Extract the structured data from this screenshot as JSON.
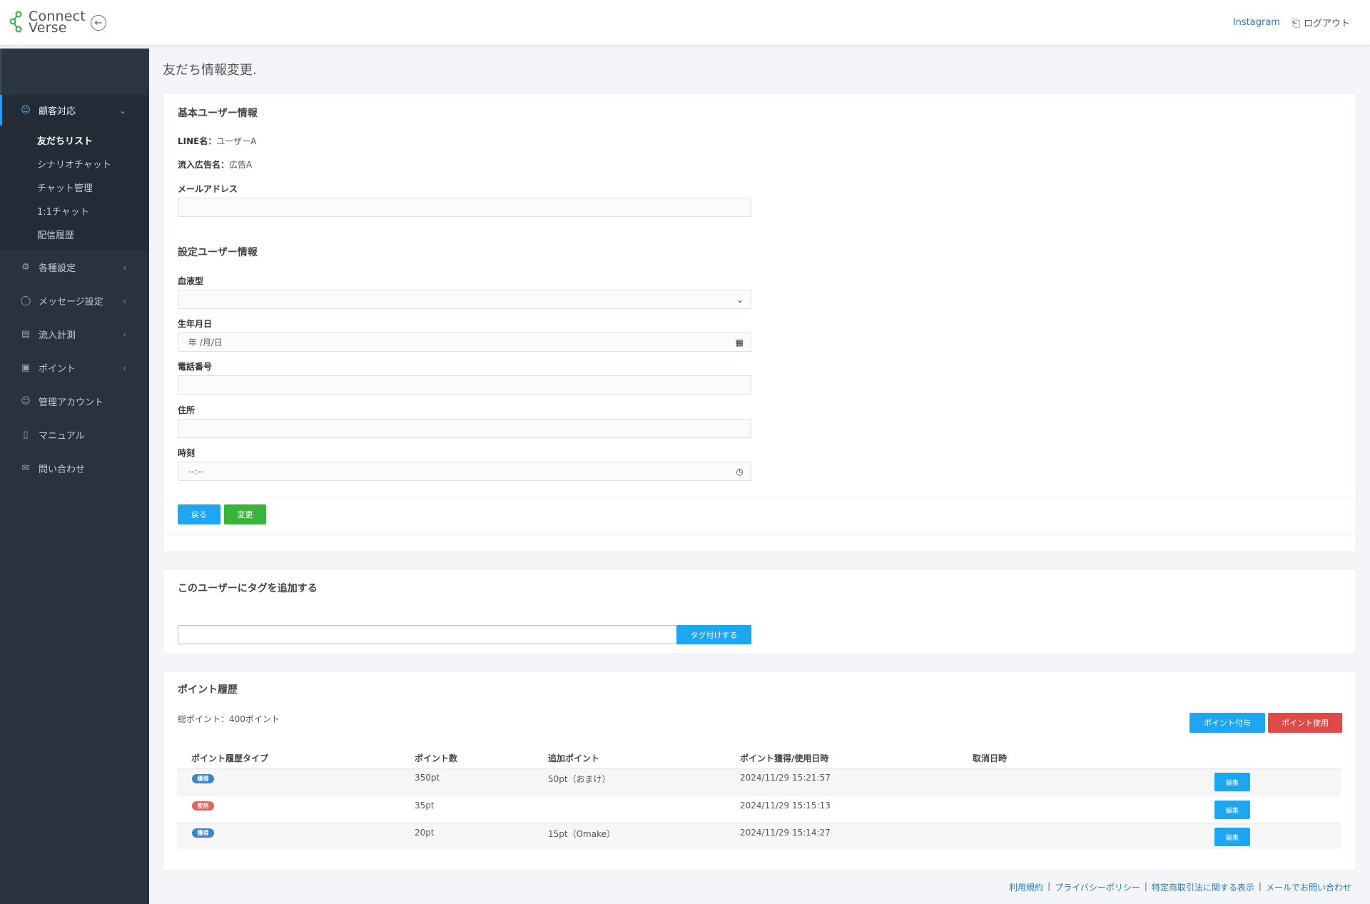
{
  "header": {
    "logo_line1": "Connect",
    "logo_line2": "Verse",
    "collapse_icon": "arrow-left-circle-icon",
    "instagram_link": "Instagram",
    "logout_label": "ログアウト"
  },
  "sidebar": {
    "active_section": "顧客対応",
    "sub_items": [
      "友だちリスト",
      "シナリオチャット",
      "チャット管理",
      "1:1チャット",
      "配信履歴"
    ],
    "active_sub": "友だちリスト",
    "items": [
      {
        "label": "各種設定",
        "icon": "gear-icon",
        "has_children": true
      },
      {
        "label": "メッセージ設定",
        "icon": "chat-bubble-icon",
        "has_children": true
      },
      {
        "label": "流入計測",
        "icon": "bar-chart-icon",
        "has_children": true
      },
      {
        "label": "ポイント",
        "icon": "gift-icon",
        "has_children": true
      },
      {
        "label": "管理アカウント",
        "icon": "user-icon",
        "has_children": false
      },
      {
        "label": "マニュアル",
        "icon": "book-icon",
        "has_children": false
      },
      {
        "label": "問い合わせ",
        "icon": "mail-icon",
        "has_children": false
      }
    ]
  },
  "page": {
    "title": "友だち情報変更."
  },
  "basic_info": {
    "title": "基本ユーザー情報",
    "line_name_label": "LINE名：",
    "line_name_value": "ユーザーA",
    "ad_label": "流入広告名：",
    "ad_value": "広告A",
    "email_label": "メールアドレス",
    "email_value": ""
  },
  "settings_info": {
    "title": "設定ユーザー情報",
    "blood_label": "血液型",
    "blood_value": "",
    "birth_label": "生年月日",
    "birth_placeholder": "年 /月/日",
    "phone_label": "電話番号",
    "phone_value": "",
    "address_label": "住所",
    "address_value": "",
    "time_label": "時刻",
    "time_placeholder": "--:--"
  },
  "form_actions": {
    "back_label": "戻る",
    "submit_label": "変更"
  },
  "tag_section": {
    "title": "このユーザーにタグを追加する",
    "input_value": "",
    "button_label": "タグ付けする"
  },
  "points": {
    "title": "ポイント履歴",
    "total_label": "総ポイント：",
    "total_value": "400ポイント",
    "grant_button": "ポイント付与",
    "use_button": "ポイント使用",
    "columns": [
      "ポイント履歴タイプ",
      "ポイント数",
      "追加ポイント",
      "ポイント獲得/使用日時",
      "取消日時"
    ],
    "edit_label": "編集",
    "rows": [
      {
        "type": "獲得",
        "type_color": "blue",
        "points": "350pt",
        "extra": "50pt（おまけ）",
        "datetime": "2024/11/29 15:21:57",
        "cancelled": ""
      },
      {
        "type": "使用",
        "type_color": "red",
        "points": "35pt",
        "extra": "",
        "datetime": "2024/11/29 15:15:13",
        "cancelled": ""
      },
      {
        "type": "獲得",
        "type_color": "blue",
        "points": "20pt",
        "extra": "15pt（Omake）",
        "datetime": "2024/11/29 15:14:27",
        "cancelled": ""
      }
    ]
  },
  "footer": {
    "links": [
      "利用規約",
      "プライバシーポリシー",
      "特定商取引法に関する表示",
      "メールでお問い合わせ"
    ],
    "separator": "|"
  },
  "colors": {
    "accent": "#1ea7f0",
    "success": "#3ab53c",
    "danger": "#dc4b47",
    "sidebar_bg": "#293340"
  }
}
